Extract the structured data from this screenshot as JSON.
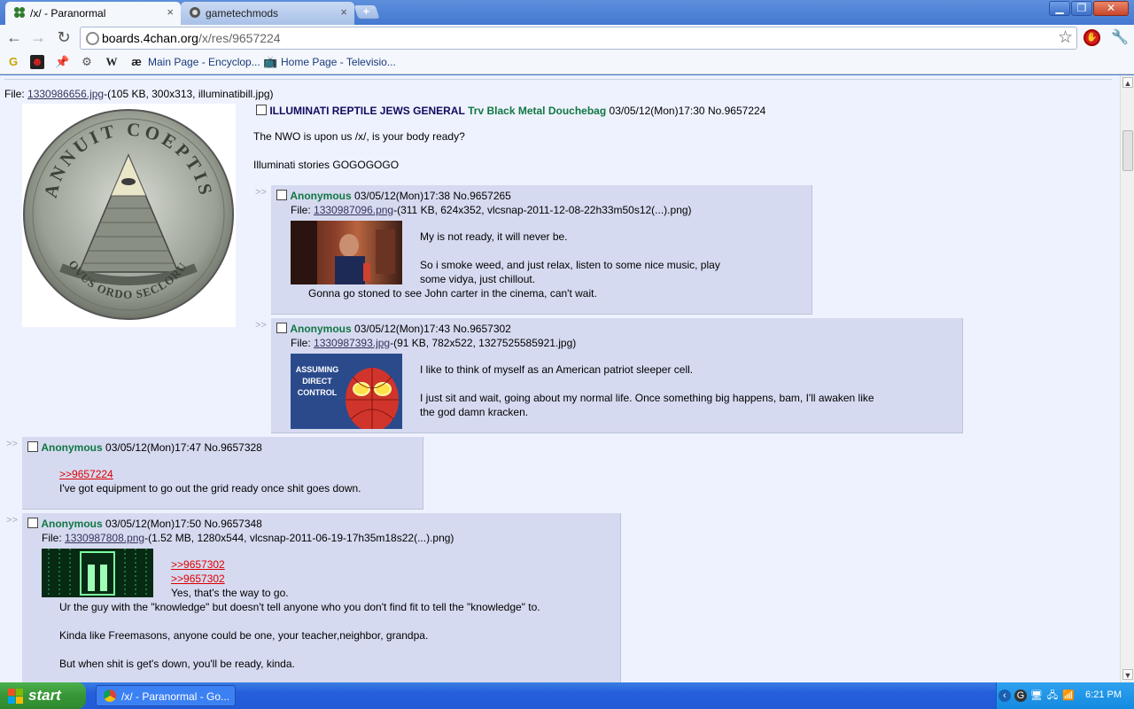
{
  "browser": {
    "tabs": [
      {
        "title": "/x/ - Paranormal",
        "active": true
      },
      {
        "title": "gametechmods",
        "active": false
      }
    ],
    "new_tab_label": "+",
    "window_buttons": {
      "minimize": "▁",
      "maximize": "❐",
      "close": "✕"
    },
    "url_host": "boards.4chan.org",
    "url_path": "/x/res/9657224",
    "bookmarks": [
      {
        "label": "Main Page - Encyclop..."
      },
      {
        "label": "Home Page - Televisio..."
      }
    ],
    "bookmark_icons": {
      "g": "G",
      "w": "W",
      "ae": "æ"
    }
  },
  "thread": {
    "op": {
      "file_label": "File:",
      "file_link": "1330986656.jpg",
      "file_meta": "-(105 KB, 300x313, illuminatibill.jpg)",
      "subject": "ILLUMINATI REPTILE JEWS GENERAL",
      "name": "Trv Black Metal Douchebag",
      "datetime": "03/05/12(Mon)17:30",
      "number": "No.9657224",
      "lines": [
        "The NWO is upon us /x/, is your body ready?",
        "Illuminati stories GOGOGOGO"
      ],
      "seal_top_text": "ANNUIT COEPTIS",
      "seal_bottom_text": "NOVUS ORDO SECLORUM"
    },
    "replies": [
      {
        "name": "Anonymous",
        "datetime": "03/05/12(Mon)17:38",
        "number": "No.9657265",
        "file_label": "File:",
        "file_link": "1330987096.png",
        "file_meta": "-(311 KB, 624x352, vlcsnap-2011-12-08-22h33m50s12(...).png)",
        "lines": [
          "My is not ready, it will never be.",
          "So i smoke weed, and just relax, listen to some nice music, play",
          "some vidya, just chillout.",
          "Gonna go stoned to see John carter in the cinema, can't wait."
        ]
      },
      {
        "name": "Anonymous",
        "datetime": "03/05/12(Mon)17:43",
        "number": "No.9657302",
        "file_label": "File:",
        "file_link": "1330987393.jpg",
        "file_meta": "-(91 KB, 782x522, 1327525585921.jpg)",
        "thumb_text": "ASSUMING DIRECT CONTROL",
        "lines": [
          "I like to think of myself as an American patriot sleeper cell.",
          "I just sit and wait, going about my normal life. Once something big happens, bam, I'll awaken like",
          "the god damn kracken."
        ]
      },
      {
        "name": "Anonymous",
        "datetime": "03/05/12(Mon)17:47",
        "number": "No.9657328",
        "quote": ">>9657224",
        "lines": [
          "I've got equipment to go out the grid ready once shit goes down."
        ]
      },
      {
        "name": "Anonymous",
        "datetime": "03/05/12(Mon)17:50",
        "number": "No.9657348",
        "file_label": "File:",
        "file_link": "1330987808.png",
        "file_meta": "-(1.52 MB, 1280x544, vlcsnap-2011-06-19-17h35m18s22(...).png)",
        "quotes": [
          ">>9657302",
          ">>9657302"
        ],
        "lines": [
          "Yes, that's the way to go.",
          "Ur the guy with the \"knowledge\" but doesn't tell anyone who you don't find fit to tell the \"knowledge\" to.",
          "Kinda like Freemasons, anyone could be one, your teacher,neighbor, grandpa.",
          "But when shit is get's down, you'll be ready, kinda."
        ]
      }
    ],
    "reply_arrow": ">>"
  },
  "taskbar": {
    "start_label": "start",
    "task_title": "/x/ - Paranormal - Go...",
    "clock": "6:21 PM"
  }
}
